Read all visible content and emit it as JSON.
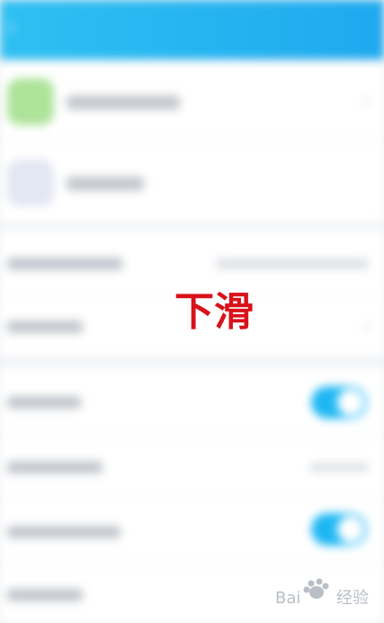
{
  "header": {
    "title": "",
    "back_icon": "back-arrow-icon"
  },
  "overlay_text": "下滑",
  "watermark": "Baidu 经验",
  "colors": {
    "accent": "#1eb7f3",
    "overlay": "#d8121a"
  }
}
